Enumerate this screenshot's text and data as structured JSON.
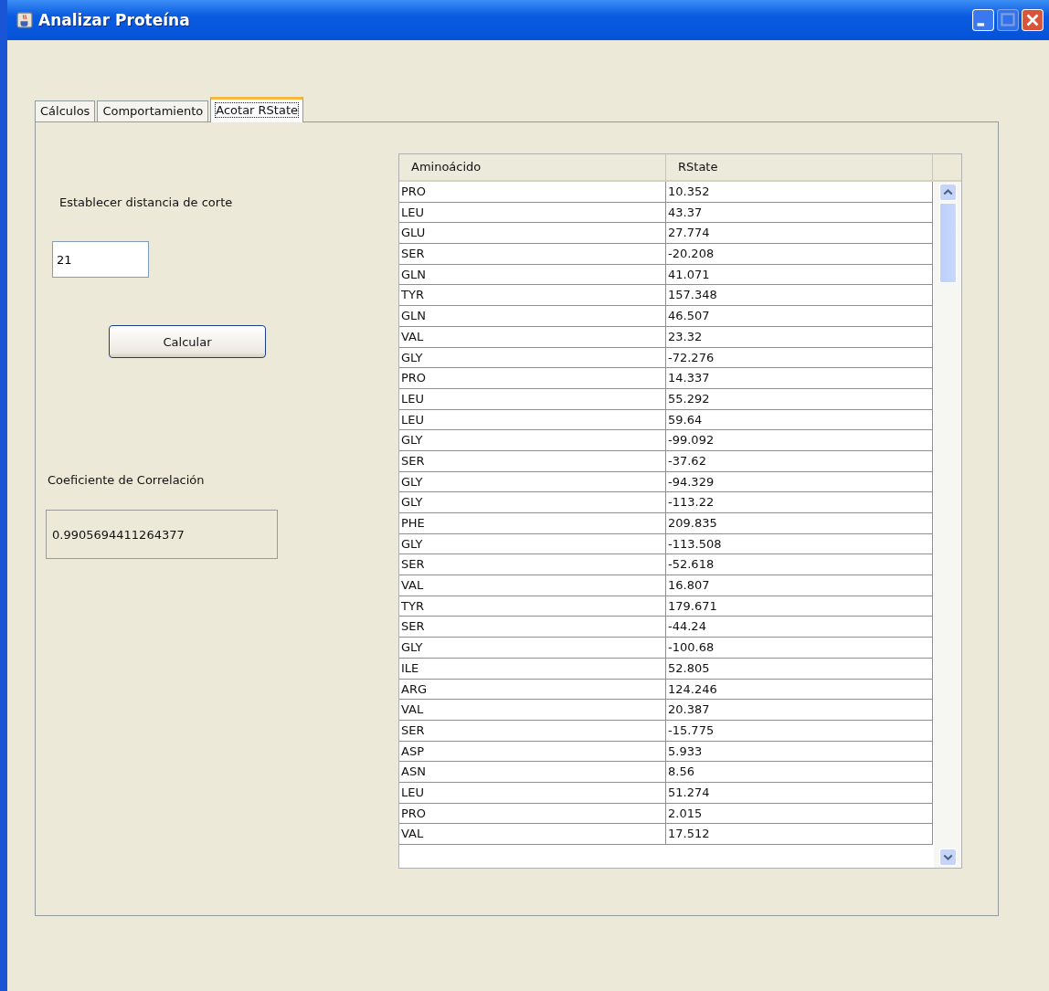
{
  "window": {
    "title": "Analizar Proteína"
  },
  "tabs": [
    {
      "label": "Cálculos",
      "selected": false
    },
    {
      "label": "Comportamiento",
      "selected": false
    },
    {
      "label": "Acotar RState",
      "selected": true
    }
  ],
  "cutoff": {
    "label": "Establecer distancia de corte",
    "value": "21"
  },
  "calculate_button": "Calcular",
  "correlation": {
    "label": "Coeficiente de Correlación",
    "value": "0.9905694411264377"
  },
  "table": {
    "columns": [
      "Aminoácido",
      "RState"
    ],
    "rows": [
      [
        "PRO",
        "10.352"
      ],
      [
        "LEU",
        "43.37"
      ],
      [
        "GLU",
        "27.774"
      ],
      [
        "SER",
        "-20.208"
      ],
      [
        "GLN",
        "41.071"
      ],
      [
        "TYR",
        "157.348"
      ],
      [
        "GLN",
        "46.507"
      ],
      [
        "VAL",
        "23.32"
      ],
      [
        "GLY",
        "-72.276"
      ],
      [
        "PRO",
        "14.337"
      ],
      [
        "LEU",
        "55.292"
      ],
      [
        "LEU",
        "59.64"
      ],
      [
        "GLY",
        "-99.092"
      ],
      [
        "SER",
        "-37.62"
      ],
      [
        "GLY",
        "-94.329"
      ],
      [
        "GLY",
        "-113.22"
      ],
      [
        "PHE",
        "209.835"
      ],
      [
        "GLY",
        "-113.508"
      ],
      [
        "SER",
        "-52.618"
      ],
      [
        "VAL",
        "16.807"
      ],
      [
        "TYR",
        "179.671"
      ],
      [
        "SER",
        "-44.24"
      ],
      [
        "GLY",
        "-100.68"
      ],
      [
        "ILE",
        "52.805"
      ],
      [
        "ARG",
        "124.246"
      ],
      [
        "VAL",
        "20.387"
      ],
      [
        "SER",
        "-15.775"
      ],
      [
        "ASP",
        "5.933"
      ],
      [
        "ASN",
        "8.56"
      ],
      [
        "LEU",
        "51.274"
      ],
      [
        "PRO",
        "2.015"
      ],
      [
        "VAL",
        "17.512"
      ]
    ]
  }
}
